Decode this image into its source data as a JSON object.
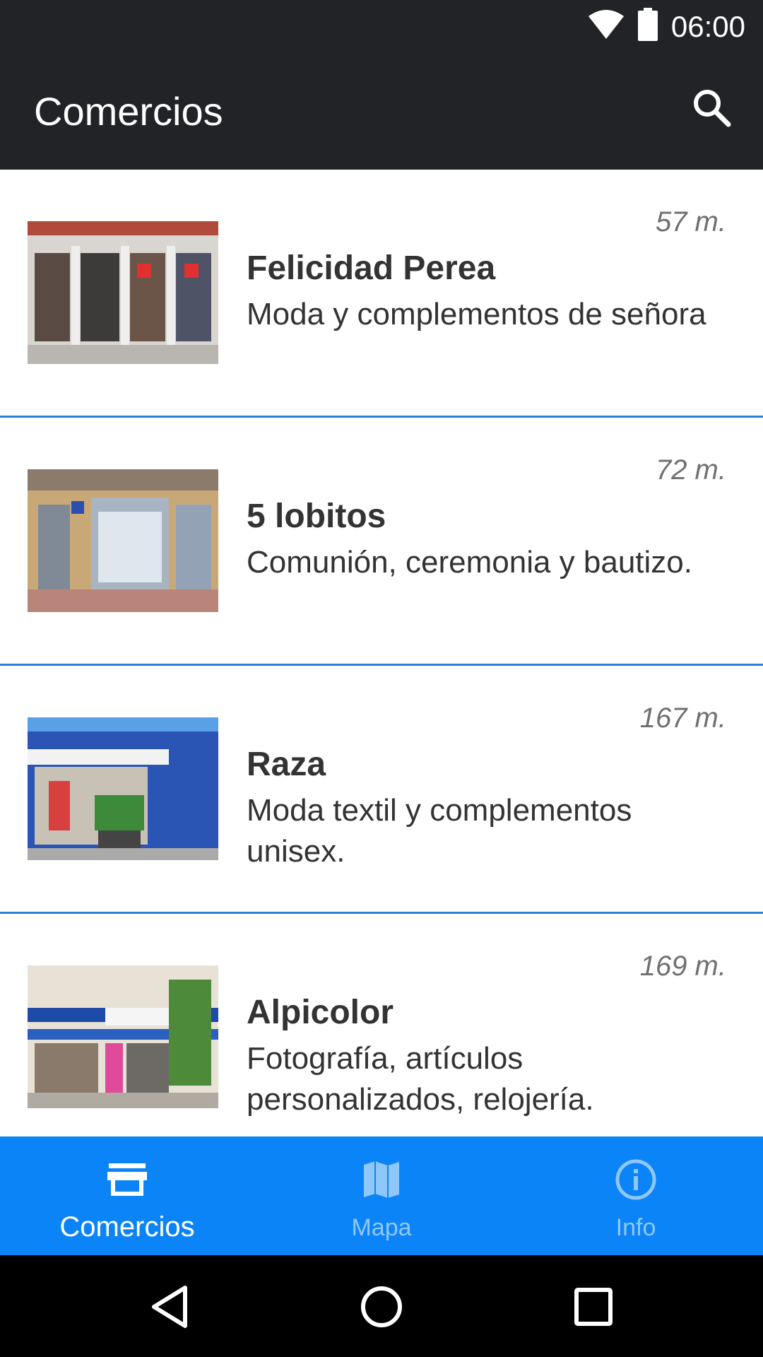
{
  "status_bar": {
    "time": "06:00",
    "icons": [
      "wifi-icon",
      "battery-icon"
    ]
  },
  "app_bar": {
    "title": "Comercios",
    "action_icon": "search-icon"
  },
  "stores": [
    {
      "name": "Felicidad Perea",
      "description": "Moda y complementos de señora",
      "distance": "57 m.",
      "image": "storefront-photo"
    },
    {
      "name": "5 lobitos",
      "description": "Comunión, ceremonia y bautizo.",
      "distance": "72 m.",
      "image": "storefront-photo"
    },
    {
      "name": "Raza",
      "description": "Moda textil y complementos unisex.",
      "distance": "167 m.",
      "image": "storefront-photo"
    },
    {
      "name": "Alpicolor",
      "description": "Fotografía, artículos personalizados, relojería.",
      "distance": "169 m.",
      "image": "storefront-photo"
    }
  ],
  "bottom_nav": {
    "items": [
      {
        "label": "Comercios",
        "icon": "store-icon",
        "active": true
      },
      {
        "label": "Mapa",
        "icon": "map-icon",
        "active": false
      },
      {
        "label": "Info",
        "icon": "info-icon",
        "active": false
      }
    ]
  },
  "system_nav": [
    "back-icon",
    "home-icon",
    "recents-icon"
  ],
  "colors": {
    "app_bar": "#222327",
    "accent": "#0a84f6",
    "divider": "#2a7fd4"
  }
}
